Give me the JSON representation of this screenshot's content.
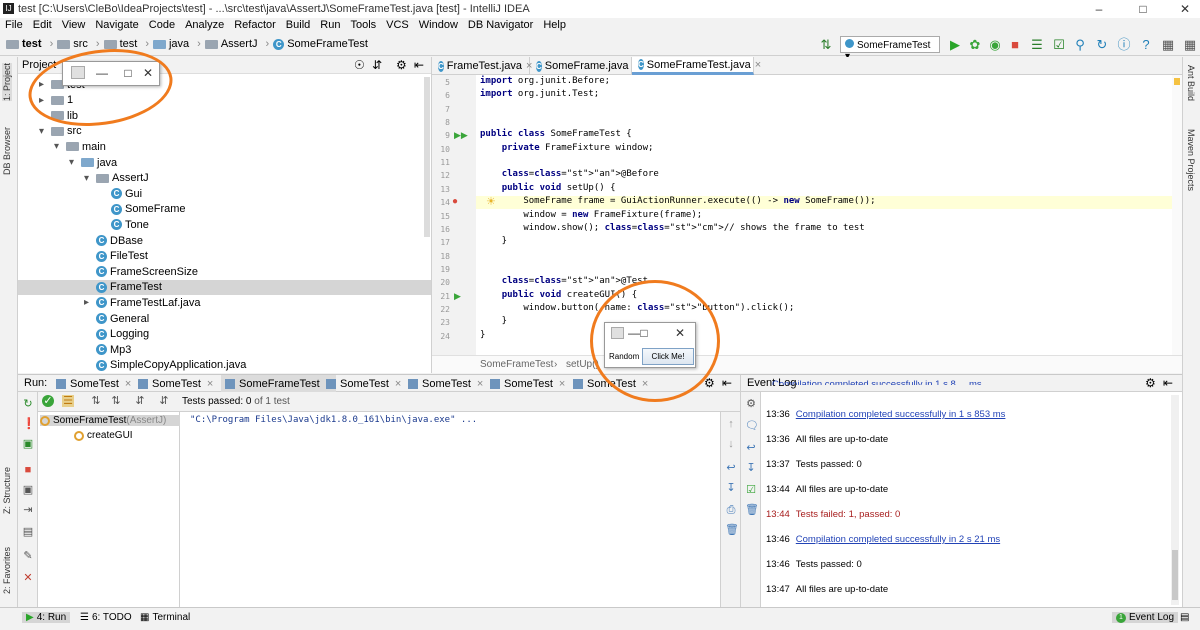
{
  "window": {
    "title": "test [C:\\Users\\CleBo\\IdeaProjects\\test] - ...\\src\\test\\java\\AssertJ\\SomeFrameTest.java [test] - IntelliJ IDEA",
    "app_icon": "IJ",
    "min": "–",
    "max": "□",
    "close": "✕"
  },
  "menu": [
    "File",
    "Edit",
    "View",
    "Navigate",
    "Code",
    "Analyze",
    "Refactor",
    "Build",
    "Run",
    "Tools",
    "VCS",
    "Window",
    "DB Navigator",
    "Help"
  ],
  "breadcrumb": {
    "items": [
      "test",
      "src",
      "test",
      "java",
      "AssertJ",
      "SomeFrameTest"
    ]
  },
  "toolbar": {
    "run_config": "SomeFrameTest ▾"
  },
  "left_stripe": {
    "project": "1: Project",
    "db_browser": "DB Browser",
    "structure": "Z: Structure",
    "favorites": "2: Favorites"
  },
  "right_stripe": {
    "ant": "Ant Build",
    "maven": "Maven Projects"
  },
  "project_panel": {
    "title": "Project",
    "tree": [
      {
        "label": "test",
        "depth": 1,
        "arrow": "▸",
        "type": "folder"
      },
      {
        "label": "1",
        "depth": 1,
        "arrow": "▸",
        "type": "folder"
      },
      {
        "label": "lib",
        "depth": 1,
        "arrow": "",
        "type": "folder"
      },
      {
        "label": "src",
        "depth": 1,
        "arrow": "▾",
        "type": "folder"
      },
      {
        "label": "main",
        "depth": 2,
        "arrow": "▾",
        "type": "folder"
      },
      {
        "label": "java",
        "depth": 3,
        "arrow": "▾",
        "type": "folderblue"
      },
      {
        "label": "AssertJ",
        "depth": 4,
        "arrow": "▾",
        "type": "folder"
      },
      {
        "label": "Gui",
        "depth": 5,
        "arrow": "",
        "type": "class"
      },
      {
        "label": "SomeFrame",
        "depth": 5,
        "arrow": "",
        "type": "class"
      },
      {
        "label": "Tone",
        "depth": 5,
        "arrow": "",
        "type": "class"
      },
      {
        "label": "DBase",
        "depth": 4,
        "arrow": "",
        "type": "class"
      },
      {
        "label": "FileTest",
        "depth": 4,
        "arrow": "",
        "type": "class"
      },
      {
        "label": "FrameScreenSize",
        "depth": 4,
        "arrow": "",
        "type": "class"
      },
      {
        "label": "FrameTest",
        "depth": 4,
        "arrow": "",
        "type": "class",
        "selected": true
      },
      {
        "label": "FrameTestLaf.java",
        "depth": 4,
        "arrow": "▸",
        "type": "class"
      },
      {
        "label": "General",
        "depth": 4,
        "arrow": "",
        "type": "class"
      },
      {
        "label": "Logging",
        "depth": 4,
        "arrow": "",
        "type": "class"
      },
      {
        "label": "Mp3",
        "depth": 4,
        "arrow": "",
        "type": "class"
      },
      {
        "label": "SimpleCopyApplication.java",
        "depth": 4,
        "arrow": "",
        "type": "class"
      }
    ]
  },
  "editor": {
    "tabs": [
      {
        "label": "FrameTest.java",
        "close": "×",
        "active": false
      },
      {
        "label": "SomeFrame.java",
        "close": "×",
        "active": false
      },
      {
        "label": "SomeFrameTest.java",
        "close": "×",
        "active": true
      }
    ],
    "lines": [
      {
        "n": "5",
        "code": "import org.junit.Before;"
      },
      {
        "n": "6",
        "code": "import org.junit.Test;"
      },
      {
        "n": "7",
        "code": ""
      },
      {
        "n": "8",
        "code": ""
      },
      {
        "n": "9",
        "code": "public class SomeFrameTest {"
      },
      {
        "n": "10",
        "code": "    private FrameFixture window;"
      },
      {
        "n": "11",
        "code": ""
      },
      {
        "n": "12",
        "code": "    @Before"
      },
      {
        "n": "13",
        "code": "    public void setUp() {"
      },
      {
        "n": "14",
        "code": "        SomeFrame frame = GuiActionRunner.execute(() -> new SomeFrame());"
      },
      {
        "n": "15",
        "code": "        window = new FrameFixture(frame);"
      },
      {
        "n": "16",
        "code": "        window.show(); // shows the frame to test"
      },
      {
        "n": "17",
        "code": "    }"
      },
      {
        "n": "18",
        "code": ""
      },
      {
        "n": "19",
        "code": ""
      },
      {
        "n": "20",
        "code": "    @Test"
      },
      {
        "n": "21",
        "code": "    public void createGUI() {"
      },
      {
        "n": "22",
        "code": "        window.button( name: \"button\").click();"
      },
      {
        "n": "23",
        "code": "    }"
      },
      {
        "n": "24",
        "code": "}"
      }
    ],
    "breadcrumb": [
      "SomeFrameTest",
      "setUp()"
    ]
  },
  "run_panel": {
    "label": "Run:",
    "tabs": [
      "SomeTest",
      "SomeTest",
      "SomeFrameTest",
      "SomeTest",
      "SomeTest",
      "SomeTest",
      "SomeTest"
    ],
    "active_tab": 2,
    "status_prefix": "Tests passed: ",
    "passed": "0",
    "status_suffix": " of 1 test",
    "tree": [
      {
        "label": "SomeFrameTest",
        "suffix": " (AssertJ)"
      },
      {
        "label": "createGUI"
      }
    ],
    "console": "\"C:\\Program Files\\Java\\jdk1.8.0_161\\bin\\java.exe\" ..."
  },
  "event_log": {
    "title": "Event Log",
    "entries": [
      {
        "time": "",
        "msg": "Compilation completed successfully in 1 s 8__ ms",
        "kind": "link",
        "partial": true
      },
      {
        "time": "13:36",
        "msg": "Compilation completed successfully in 1 s 853 ms",
        "kind": "link"
      },
      {
        "time": "13:36",
        "msg": "All files are up-to-date",
        "kind": "normal"
      },
      {
        "time": "13:37",
        "msg": "Tests passed: 0",
        "kind": "normal"
      },
      {
        "time": "13:44",
        "msg": "All files are up-to-date",
        "kind": "normal"
      },
      {
        "time": "13:44",
        "msg": "Tests failed: 1, passed: 0",
        "kind": "err"
      },
      {
        "time": "13:46",
        "msg": "Compilation completed successfully in 2 s 21 ms",
        "kind": "link"
      },
      {
        "time": "13:46",
        "msg": "Tests passed: 0",
        "kind": "normal"
      },
      {
        "time": "13:47",
        "msg": "All files are up-to-date",
        "kind": "normal"
      }
    ]
  },
  "status_bar": {
    "run": "4: Run",
    "todo": "6: TODO",
    "terminal": "Terminal",
    "event_log": "Event Log",
    "event_count": "1"
  },
  "floating_window_1": {
    "min": "—",
    "max": "□",
    "close": "✕"
  },
  "floating_window_2": {
    "min": "—",
    "max": "□",
    "close": "✕",
    "label": "Random",
    "button": "Click Me!"
  },
  "colors": {
    "accent": "#3f96c9",
    "annotation_circle": "#f07b1e",
    "error": "#a71d1d",
    "link": "#2243b6"
  }
}
